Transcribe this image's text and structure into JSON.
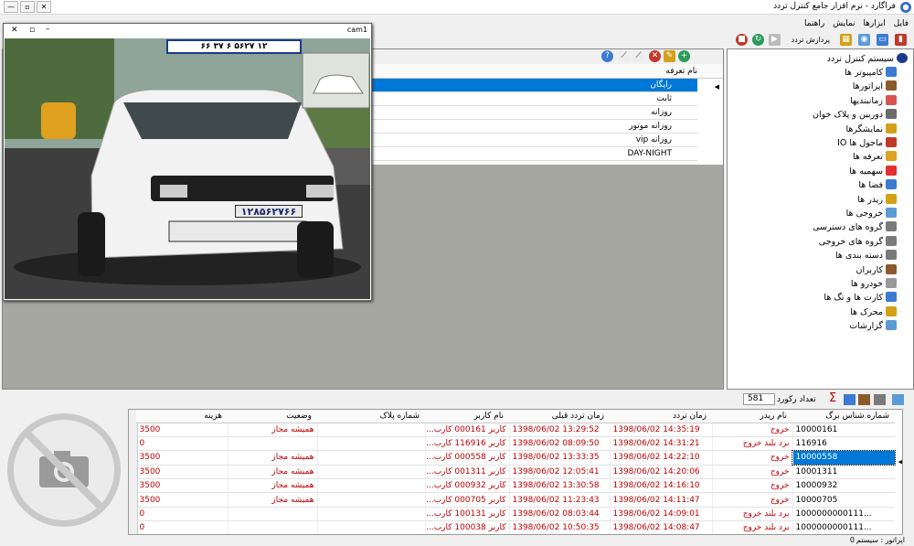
{
  "window": {
    "title": "فراگارد - نرم افزار جامع کنترل تردد"
  },
  "menu": [
    "فایل",
    "ابزارها",
    "نمایش",
    "راهنما"
  ],
  "toolbar": {
    "traffic_process_label": "پردازش تردد"
  },
  "tree": {
    "root": "سیستم کنترل تردد",
    "items": [
      {
        "label": "کامپیوتر ها",
        "color": "#3b7bd1"
      },
      {
        "label": "اپراتورها",
        "color": "#8a5a2b"
      },
      {
        "label": "زمانبندیها",
        "color": "#d9534f"
      },
      {
        "label": "دوربین و پلاک خوان",
        "color": "#6b6b6b"
      },
      {
        "label": "نمایشگرها",
        "color": "#d4a017"
      },
      {
        "label": "ماجول ها IO",
        "color": "#c0392b"
      },
      {
        "label": "تعرفه ها",
        "color": "#e0a020"
      },
      {
        "label": "سهمیه ها",
        "color": "#e03030"
      },
      {
        "label": "فضا ها",
        "color": "#3b7bd1"
      },
      {
        "label": "ریدر ها",
        "color": "#d4a017"
      },
      {
        "label": "خروجی ها",
        "color": "#5b9bd5"
      },
      {
        "label": "گروه های دسترسی",
        "color": "#7a7a7a"
      },
      {
        "label": "گروه های خروجی",
        "color": "#7a7a7a"
      },
      {
        "label": "دسته بندی ها",
        "color": "#7a7a7a"
      },
      {
        "label": "کاربران",
        "color": "#8a5a2b"
      },
      {
        "label": "خودرو ها",
        "color": "#999999"
      },
      {
        "label": "کارت ها و تگ ها",
        "color": "#3b7bd1"
      },
      {
        "label": "محرک ها",
        "color": "#d4a017"
      },
      {
        "label": "گزارشات",
        "color": "#5b9bd5"
      }
    ]
  },
  "tariff": {
    "header": "نام تعرفه",
    "rows": [
      "رایگان",
      "ثابت",
      "روزانه",
      "روزانه موتور",
      "روزانه vip",
      "DAY-NIGHT"
    ]
  },
  "camera": {
    "title": "cam1",
    "plate_text": "۱۲۸۵۶۲۷۶۶",
    "plate_small": "۱۲۸۵۶۲۷۶۶",
    "plate_top": "۶۶  ۳۷ ۶ ۵۶۲۷ ۱۲"
  },
  "records": {
    "count_label": "تعداد رکورد",
    "count": "581"
  },
  "log": {
    "headers": [
      "شماره شناس برگ",
      "نام ریدر",
      "زمان تردد",
      "زمان تردد قبلی",
      "نام کاربر",
      "شماره پلاک",
      "وضعیت",
      "هزینه"
    ],
    "rows": [
      [
        "10000161",
        "خروج",
        "1398/06/02 14:35:19",
        "1398/06/02 13:29:52",
        "کاربر 000161 کارب...",
        "",
        "همیشه مجاز",
        "3500"
      ],
      [
        "116916",
        "برد بلند خروج",
        "1398/06/02 14:31:21",
        "1398/06/02 08:09:50",
        "کاربر 116916 کارب...",
        "",
        "",
        "0"
      ],
      [
        "10000558",
        "خروج",
        "1398/06/02 14:22:10",
        "1398/06/02 13:33:35",
        "کاربر 000558 کارب...",
        "",
        "همیشه مجاز",
        "3500"
      ],
      [
        "10001311",
        "خروج",
        "1398/06/02 14:20:06",
        "1398/06/02 12:05:41",
        "کاربر 001311 کارب...",
        "",
        "همیشه مجاز",
        "3500"
      ],
      [
        "10000932",
        "خروج",
        "1398/06/02 14:16:10",
        "1398/06/02 13:30:58",
        "کاربر 000932 کارب...",
        "",
        "همیشه مجاز",
        "3500"
      ],
      [
        "10000705",
        "خروج",
        "1398/06/02 14:11:47",
        "1398/06/02 11:23:43",
        "کاربر 000705 کارب...",
        "",
        "همیشه مجاز",
        "3500"
      ],
      [
        "1000000000111...",
        "برد بلند خروج",
        "1398/06/02 14:09:01",
        "1398/06/02 08:03:44",
        "کاربر 100131 کارب...",
        "",
        "",
        "0"
      ],
      [
        "1000000000111...",
        "برد بلند خروج",
        "1398/06/02 14:08:47",
        "1398/06/02 10:50:35",
        "کاربر 100038 کارب...",
        "",
        "",
        "0"
      ]
    ],
    "selected_row": 2
  },
  "status": {
    "operator_label": "اپراتور : سیستم",
    "value": "0"
  }
}
